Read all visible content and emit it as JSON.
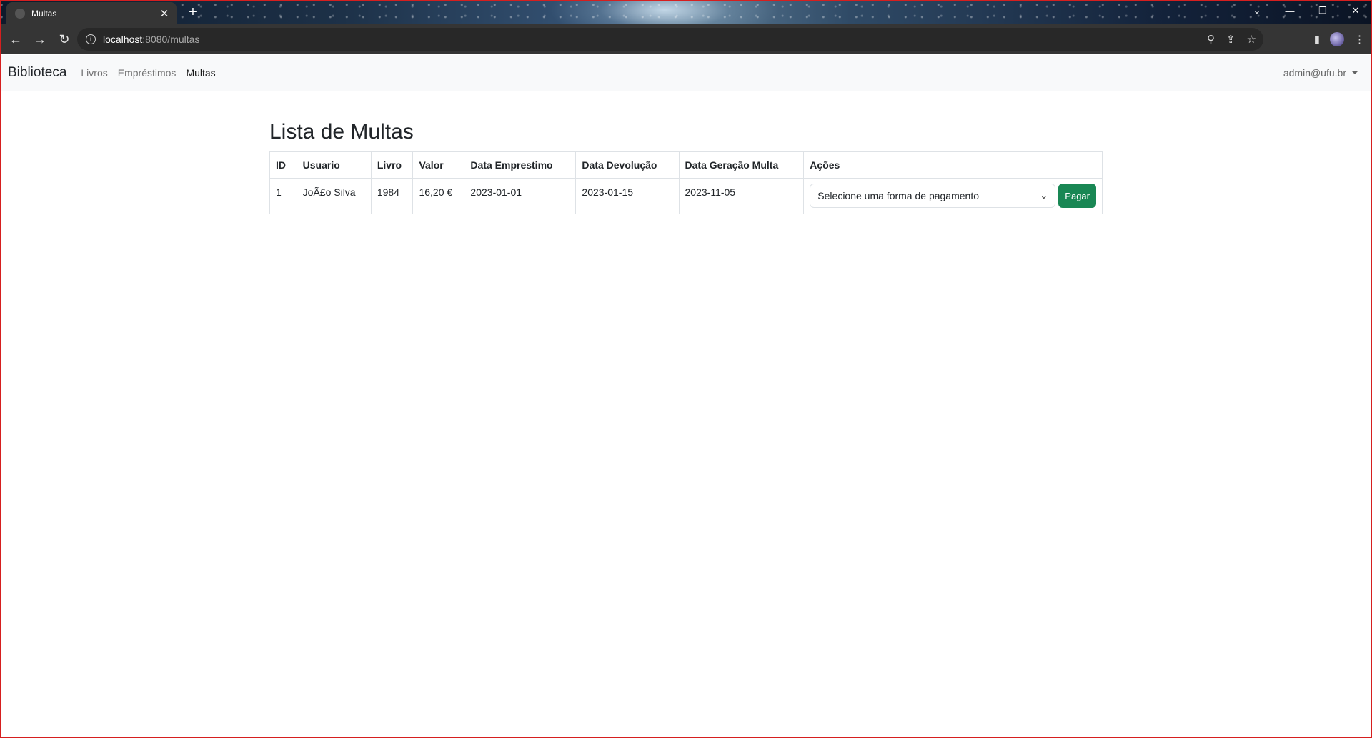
{
  "browser": {
    "tab_title": "Multas",
    "tab_close": "✕",
    "new_tab": "+",
    "url_host": "localhost",
    "url_path": ":8080/multas",
    "window_controls": [
      "⌄",
      "—",
      "❐",
      "✕"
    ]
  },
  "navbar": {
    "brand": "Biblioteca",
    "links": [
      "Livros",
      "Empréstimos",
      "Multas"
    ],
    "active": "Multas",
    "user": "admin@ufu.br"
  },
  "page": {
    "title": "Lista de Multas"
  },
  "table": {
    "headers": [
      "ID",
      "Usuario",
      "Livro",
      "Valor",
      "Data Emprestimo",
      "Data Devolução",
      "Data Geração Multa",
      "Ações"
    ],
    "rows": [
      {
        "id": "1",
        "usuario": "JoÃ£o Silva",
        "livro": "1984",
        "valor": "16,20 €",
        "data_emprestimo": "2023-01-01",
        "data_devolucao": "2023-01-15",
        "data_geracao": "2023-11-05",
        "select_value": "Selecione uma forma de pagamento",
        "pay_label": "Pagar"
      }
    ]
  },
  "colors": {
    "pay_button": "#198754",
    "navbar_bg": "#f8f9fa",
    "frame": "#d61f1f"
  },
  "icons": [
    "info-icon",
    "back-arrow-icon",
    "forward-arrow-icon",
    "reload-icon",
    "zoom-icon",
    "share-icon",
    "star-icon",
    "sidebar-icon",
    "profile-avatar",
    "menu-kebab-icon",
    "chevron-down-icon",
    "caret-down-icon"
  ]
}
